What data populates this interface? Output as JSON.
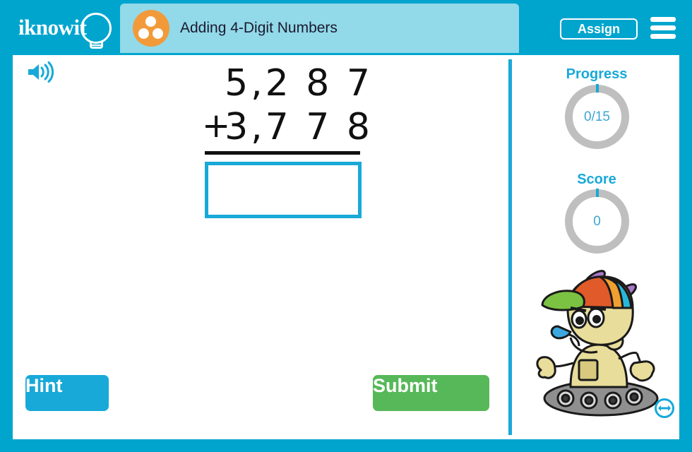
{
  "brand": {
    "logo_text": "iknowit",
    "logo_icon": "lightbulb-icon"
  },
  "header": {
    "title": "Adding 4-Digit Numbers",
    "badge_icon": "three-dots-circle-icon",
    "assign_label": "Assign",
    "menu_icon": "hamburger-menu-icon"
  },
  "toolbar": {
    "audio_icon": "speaker-icon"
  },
  "problem": {
    "addend_1": "5,2 8 7",
    "operator": "+",
    "addend_2": "3,7 7 8",
    "answer_value": "",
    "answer_placeholder": ""
  },
  "sidebar": {
    "progress_label": "Progress",
    "progress_value": "0/15",
    "score_label": "Score",
    "score_value": "0",
    "mascot_icon": "robot-mascot-icon",
    "resize_icon": "resize-horizontal-icon"
  },
  "actions": {
    "hint_label": "Hint",
    "submit_label": "Submit"
  },
  "colors": {
    "frame_blue": "#00a5ce",
    "title_strip_blue": "#92d9e9",
    "accent_blue": "#18a9d8",
    "badge_orange": "#f29a3a",
    "submit_green": "#57b859",
    "ring_gray": "#bfbfbf"
  }
}
